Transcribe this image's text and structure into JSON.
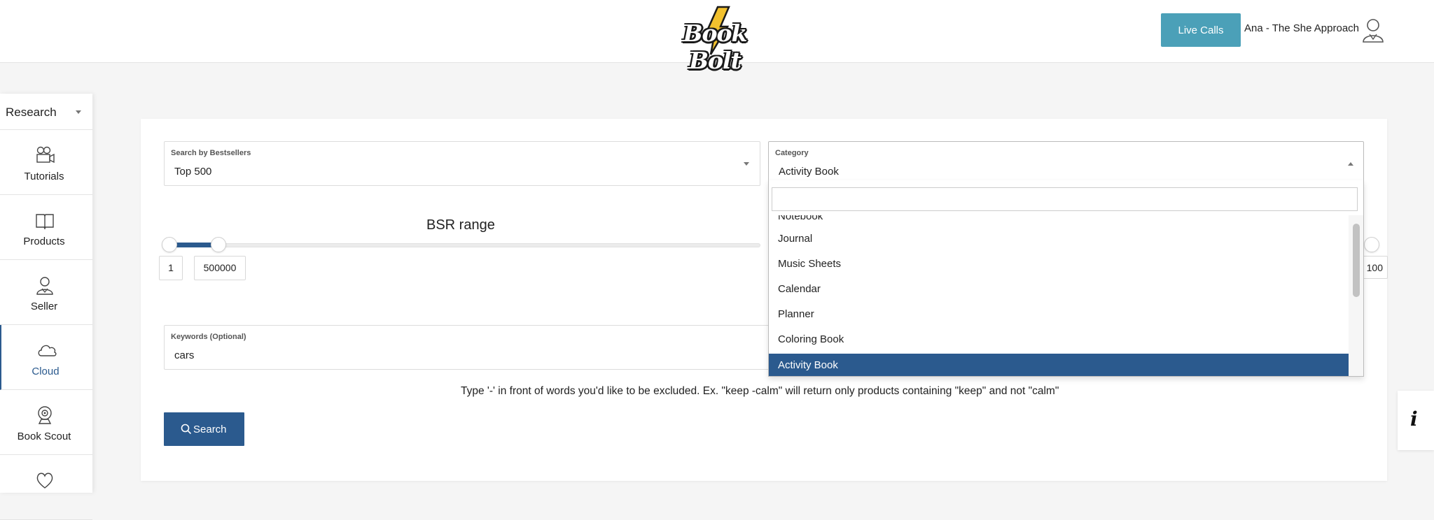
{
  "header": {
    "logo_text": "Book Bolt",
    "live_calls_label": "Live Calls",
    "user_name": "Ana - The She Approach"
  },
  "sidebar": {
    "section_select": "Research",
    "items": [
      {
        "label": "Tutorials",
        "icon": "movie-camera-icon"
      },
      {
        "label": "Products",
        "icon": "open-book-icon"
      },
      {
        "label": "Seller",
        "icon": "person-icon"
      },
      {
        "label": "Cloud",
        "icon": "cloud-icon",
        "active": true
      },
      {
        "label": "Book Scout",
        "icon": "webcam-icon"
      },
      {
        "label": "",
        "icon": "heart-icon"
      }
    ]
  },
  "form": {
    "bestsellers": {
      "label": "Search by Bestsellers",
      "value": "Top 500"
    },
    "category": {
      "label": "Category",
      "value": "Activity Book"
    },
    "bsr": {
      "title": "BSR range",
      "min": "1",
      "max": "500000",
      "right_value": "100"
    },
    "keywords": {
      "label": "Keywords (Optional)",
      "value": "cars"
    },
    "hint": "Type '-' in front of words you'd like to be excluded. Ex. \"keep -calm\" will return only products containing \"keep\" and not \"calm\"",
    "search_label": "Search"
  },
  "dropdown": {
    "search_value": "",
    "options": [
      "Notebook",
      "Journal",
      "Music Sheets",
      "Calendar",
      "Planner",
      "Coloring Book",
      "Activity Book"
    ],
    "selected": "Activity Book"
  },
  "info_label": "i",
  "colors": {
    "primary": "#2b5a8e",
    "live_calls": "#4ba0b8",
    "bolt": "#f2c12e"
  }
}
